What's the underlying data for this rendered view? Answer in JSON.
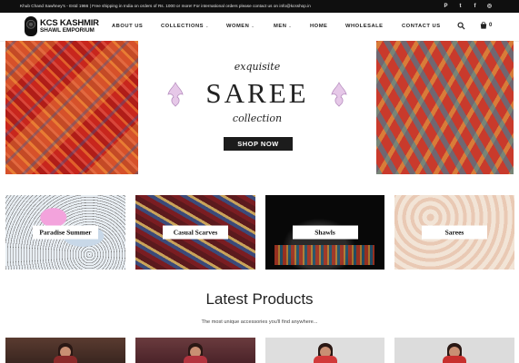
{
  "topbar": {
    "message": "Khub Chand Sawhney's - Estd 1966 | Free shipping in India on orders of Rs. 1000 or more! For international orders please contact us on info@kcsshop.in",
    "social": [
      {
        "icon": "pinterest-icon",
        "glyph": "P"
      },
      {
        "icon": "twitter-icon",
        "glyph": "t"
      },
      {
        "icon": "facebook-icon",
        "glyph": "f"
      },
      {
        "icon": "instagram-icon",
        "glyph": "◎"
      }
    ]
  },
  "header": {
    "logo_line1": "KCS KASHMIR",
    "logo_line2": "SHAWL EMPORIUM",
    "nav": [
      {
        "label": "ABOUT US",
        "caret": ""
      },
      {
        "label": "COLLECTIONS",
        "caret": "⌄"
      },
      {
        "label": "WOMEN",
        "caret": "⌄"
      },
      {
        "label": "MEN",
        "caret": "⌄"
      },
      {
        "label": "HOME",
        "caret": ""
      },
      {
        "label": "WHOLESALE",
        "caret": ""
      },
      {
        "label": "CONTACT US",
        "caret": ""
      }
    ],
    "cart_count": "0"
  },
  "hero": {
    "line_top": "exquisite",
    "line_big": "SAREE",
    "line_bottom": "collection",
    "cta": "SHOP NOW"
  },
  "categories": [
    {
      "label": "Paradise Summer"
    },
    {
      "label": "Casual Scarves"
    },
    {
      "label": "Shawls"
    },
    {
      "label": "Sarees"
    }
  ],
  "latest": {
    "title": "Latest Products",
    "subtitle": "The most unique accessories you'll find anywhere..."
  },
  "colors": {
    "topbar_bg": "#0f0f0f",
    "cta_bg": "#1c1c1c",
    "text": "#222222"
  }
}
